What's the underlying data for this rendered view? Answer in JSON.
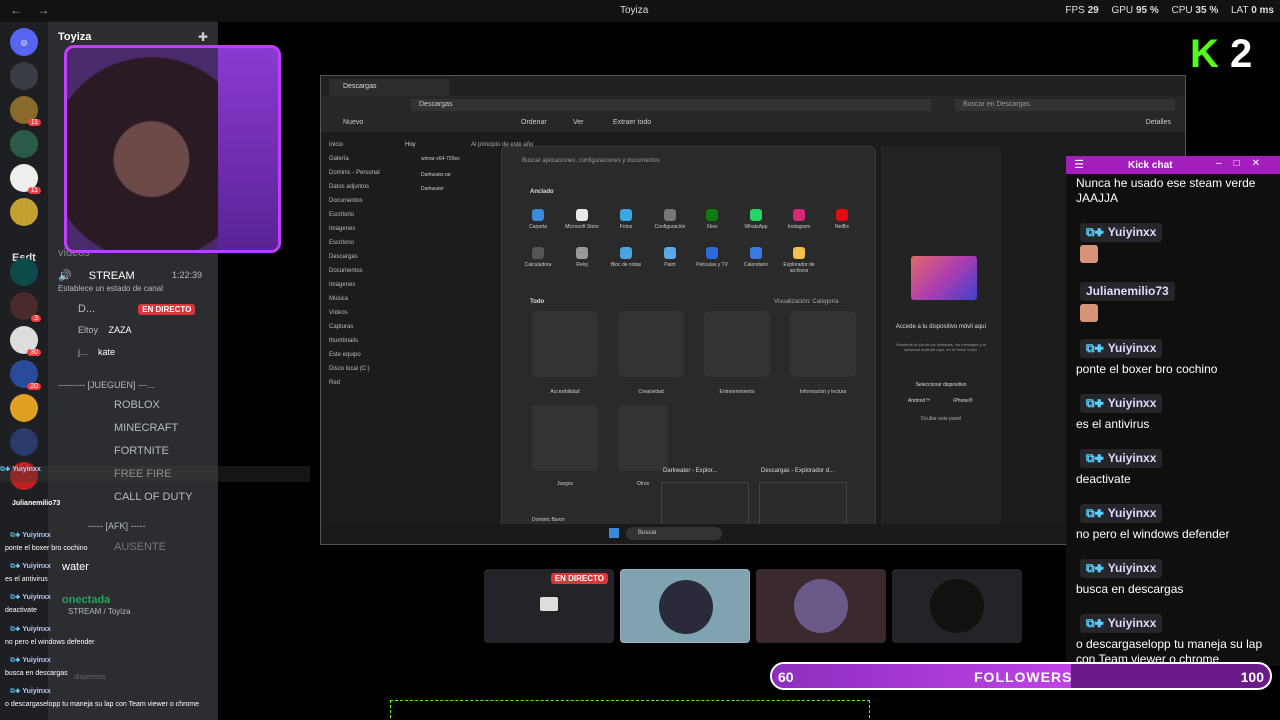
{
  "window": {
    "title": "Toyiza",
    "nav_back": "←",
    "nav_forward": "→",
    "stats": {
      "fps_label": "FPS",
      "fps": "29",
      "gpu_label": "GPU",
      "gpu": "95 %",
      "cpu_label": "CPU",
      "cpu": "35 %",
      "lat_label": "LAT",
      "lat": "0 ms"
    }
  },
  "rail": {
    "esdt": "Esdt",
    "badges": [
      "11",
      "11",
      "3",
      "30",
      "20"
    ]
  },
  "channels": {
    "server_name": "Toyiza",
    "stream_channel": "STREAM",
    "stream_time": "1:22:39",
    "channel_status": "Establece un estado de canal",
    "videos_label": "videos",
    "members": [
      {
        "name": "D...",
        "tag": "EN DIRECTO"
      },
      {
        "name": "Eltoy",
        "tag": "ZAZA"
      },
      {
        "name": "j...",
        "tag": "kate"
      }
    ],
    "category": "--------- [JUEGUEN] ---...",
    "games": [
      "ROBLOX",
      "MINECRAFT",
      "FORTNITE",
      "FREE FIRE",
      "CALL OF DUTY"
    ],
    "afk": "----- [AFK] -----",
    "ausente": "AUSENTE",
    "voice_name": "water",
    "voice_status": "onectada",
    "voice_sub": "STREAM / Toyiza",
    "dispenses": "dispenses"
  },
  "explorer": {
    "tab": "Descargas",
    "path": "Descargas",
    "search": "Buscar en Descargas",
    "toolbar": [
      "Nuevo",
      "Ordenar",
      "Ver",
      "Extraer todo",
      "Detalles"
    ],
    "tree": [
      "Inicio",
      "Galería",
      "Dominic - Personal",
      "Datos adjuntos",
      "Documentos",
      "Escritorio",
      "Imágenes",
      "Escritorio",
      "Descargas",
      "Documentos",
      "Imágenes",
      "Música",
      "Vídeos",
      "Capturas",
      "thumbnails",
      "Este equipo",
      "Disco local (C:)",
      "Red"
    ],
    "col_hoy": "Hoy",
    "col_principio": "Al principio de este año",
    "files": [
      "winrar-x64-720es",
      "Darkwater.rar",
      "Darkwater"
    ]
  },
  "startmenu": {
    "search": "Buscar aplicaciones, configuraciones y documentos",
    "pinned_title": "Anclado",
    "pinned": [
      "Carpeta",
      "Microsoft Store",
      "Fotos",
      "Configuración",
      "Xbox",
      "WhatsApp",
      "Instagram",
      "Netflix",
      "Calculadora",
      "Reloj",
      "Bloc de notas",
      "Paint",
      "Películas y TV",
      "Calendario",
      "Explorador de archivos"
    ],
    "all_title": "Todo",
    "view_label": "Visualización: Categoría",
    "categories": [
      "Accesibilidad",
      "Creatividad",
      "Entretenimiento",
      "Información y lectura",
      "Juegos",
      "Otros"
    ],
    "user": "Dominic Baron",
    "phone_title": "Accede a tu dispositivo móvil aquí",
    "phone_text": "Mantente al día de las llamadas, los mensajes y la actividad reciente aquí, en el menú Inicio.",
    "phone_select": "Seleccionar dispositivo",
    "phone_android": "Android™",
    "phone_iphone": "iPhone®",
    "phone_hide": "Ocultar este panel",
    "thumb1": "Darkwater - Explor...",
    "thumb2": "Descargas - Explorador d...",
    "taskbar_search": "Buscar"
  },
  "tiles": {
    "live": "EN DIRECTO"
  },
  "logo": {
    "k": "K",
    "num": "2"
  },
  "kick": {
    "title": "Kick chat",
    "first_msg": "Nunca he usado ese steam verde JAAJJA",
    "users": [
      "Yuiyinxx",
      "Julianemilio73",
      "Yuiyinxx",
      "Yuiyinxx",
      "Yuiyinxx",
      "Yuiyinxx",
      "Yuiyinxx",
      "Yuiyinxx"
    ],
    "messages": [
      "ponte el boxer bro cochino",
      "es el antivirus",
      "deactivate",
      "no pero el windows defender",
      "busca en descargas",
      "o descargaselopp tu maneja su lap con Team viewer o chrome"
    ]
  },
  "overlay_chat": {
    "rows": [
      {
        "user": "Yuiyinxx",
        "msg": ""
      },
      {
        "user": "Julianemilio73",
        "msg": ""
      },
      {
        "user": "Yuiyinxx",
        "msg": "ponte el boxer bro cochino"
      },
      {
        "user": "Yuiyinxx",
        "msg": "es el antivirus"
      },
      {
        "user": "Yuiyinxx",
        "msg": "deactivate"
      },
      {
        "user": "Yuiyinxx",
        "msg": "no pero el windows defender"
      },
      {
        "user": "Yuiyinxx",
        "msg": "busca en descargas"
      },
      {
        "user": "Yuiyinxx",
        "msg": "o descargaselopp tu maneja su lap con Team viewer o chrome"
      }
    ]
  },
  "followers": {
    "current": "60",
    "label": "FOLLOWERS",
    "goal": "100",
    "progress": 0.6
  },
  "colors": {
    "kick_green": "#53fc18",
    "kick_purple": "#a21fbe",
    "discord_live": "#da373c"
  }
}
